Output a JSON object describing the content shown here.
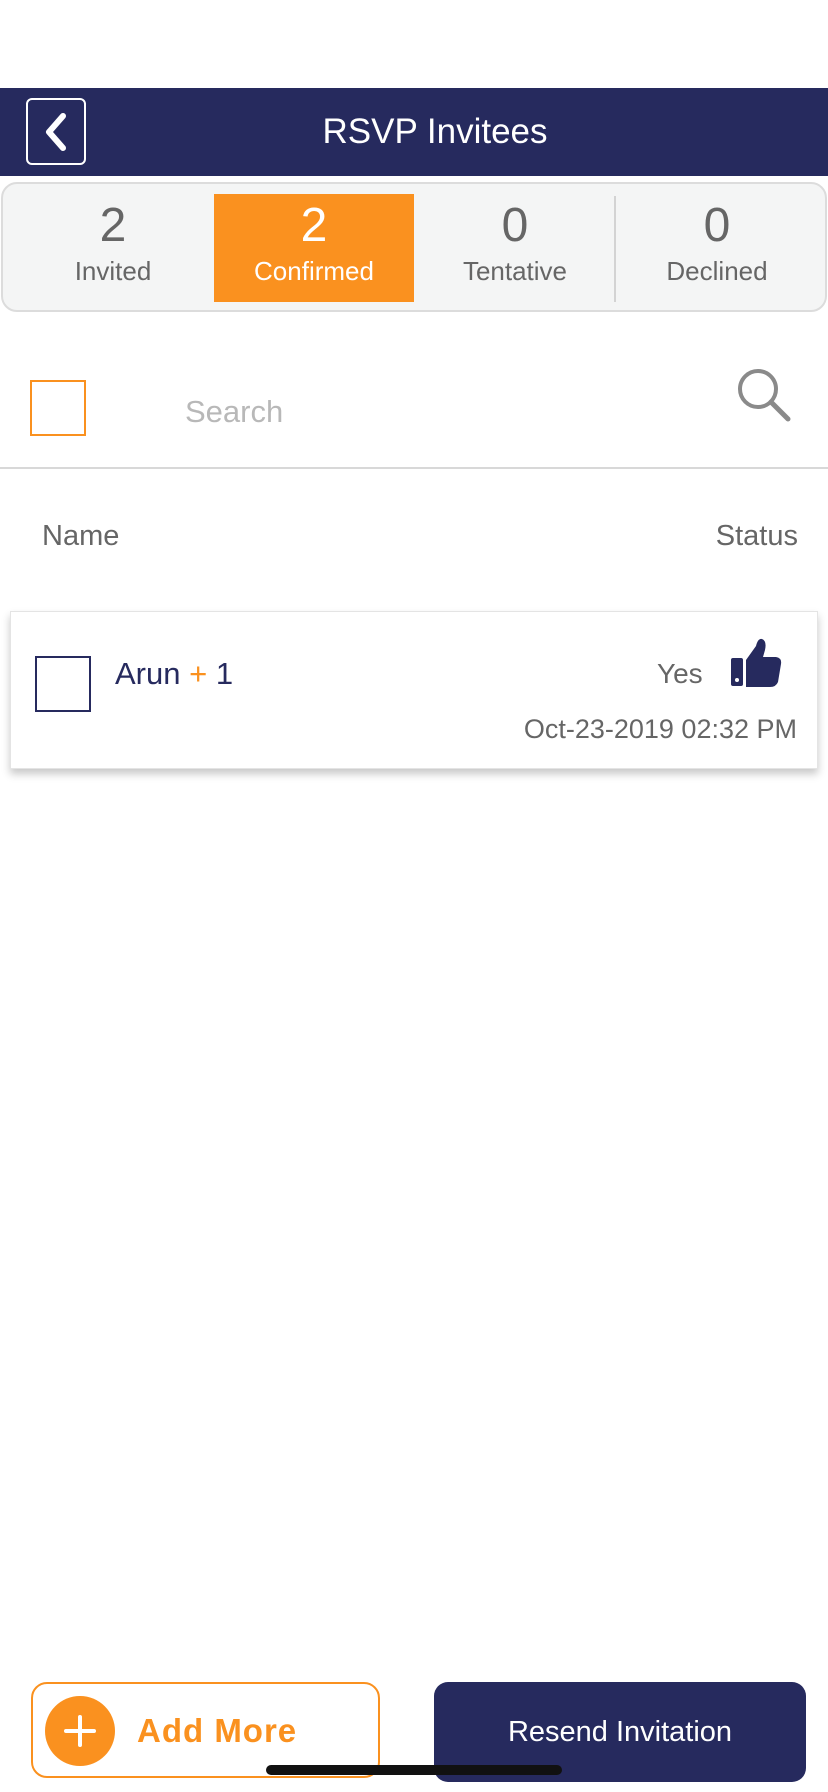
{
  "header": {
    "title": "RSVP Invitees"
  },
  "stats": [
    {
      "count": "2",
      "label": "Invited",
      "active": false
    },
    {
      "count": "2",
      "label": "Confirmed",
      "active": true
    },
    {
      "count": "0",
      "label": "Tentative",
      "active": false
    },
    {
      "count": "0",
      "label": "Declined",
      "active": false
    }
  ],
  "search": {
    "placeholder": "Search",
    "value": ""
  },
  "columns": {
    "name": "Name",
    "status": "Status"
  },
  "invitees": [
    {
      "name": "Arun",
      "plus_sign": "+",
      "plus_count": "1",
      "status": "Yes",
      "status_icon": "thumbs-up-icon",
      "timestamp": "Oct-23-2019 02:32 PM"
    }
  ],
  "footer": {
    "add_more_label": "Add More",
    "resend_label": "Resend Invitation"
  },
  "colors": {
    "navy": "#262a5e",
    "orange": "#fa911f",
    "gray_text": "#666666"
  }
}
